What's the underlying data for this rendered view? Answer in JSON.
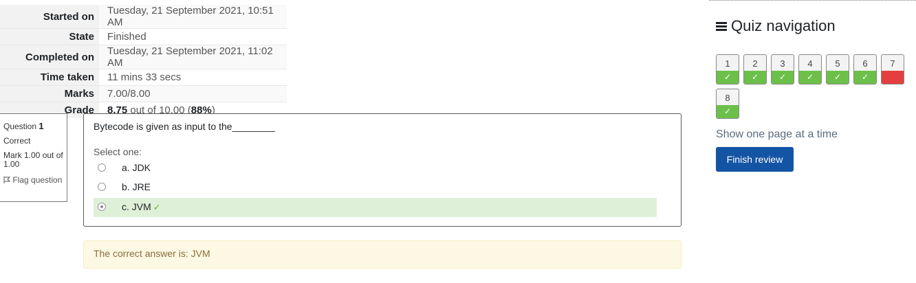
{
  "summary": {
    "rows": [
      {
        "label": "Started on",
        "value": "Tuesday, 21 September 2021, 10:51 AM"
      },
      {
        "label": "State",
        "value": "Finished"
      },
      {
        "label": "Completed on",
        "value": "Tuesday, 21 September 2021, 11:02 AM"
      },
      {
        "label": "Time taken",
        "value": "11 mins 33 secs"
      },
      {
        "label": "Marks",
        "value": "7.00/8.00"
      }
    ],
    "grade_label": "Grade",
    "grade_value": "8.75",
    "grade_mid": " out of 10.00 (",
    "grade_percent": "88%",
    "grade_end": ")"
  },
  "question": {
    "number_prefix": "Question",
    "number": "1",
    "state": "Correct",
    "mark": "Mark 1.00 out of 1.00",
    "flag_label": "Flag question",
    "text": "Bytecode is given as input to the________",
    "prompt": "Select one:",
    "options": [
      {
        "label": "a. JDK",
        "selected": false,
        "correct": false
      },
      {
        "label": "b. JRE",
        "selected": false,
        "correct": false
      },
      {
        "label": "c. JVM",
        "selected": true,
        "correct": true
      }
    ],
    "feedback": "The correct answer is: JVM"
  },
  "quiz_nav": {
    "title": "Quiz navigation",
    "buttons": [
      {
        "num": "1",
        "status": "correct"
      },
      {
        "num": "2",
        "status": "correct"
      },
      {
        "num": "3",
        "status": "correct"
      },
      {
        "num": "4",
        "status": "correct"
      },
      {
        "num": "5",
        "status": "correct"
      },
      {
        "num": "6",
        "status": "correct"
      },
      {
        "num": "7",
        "status": "incorrect"
      },
      {
        "num": "8",
        "status": "correct"
      }
    ],
    "show_one_page": "Show one page at a time",
    "finish_review": "Finish review"
  },
  "colors": {
    "correct": "#6cc04a",
    "incorrect": "#e53e3e",
    "primary": "#1454a4",
    "feedback_bg": "#fcf8e3",
    "correct_answer_bg": "#dff0d8"
  },
  "icons": {
    "nav_header": "hamburger-icon",
    "flag": "flag-icon",
    "correct_mark": "check-icon"
  }
}
